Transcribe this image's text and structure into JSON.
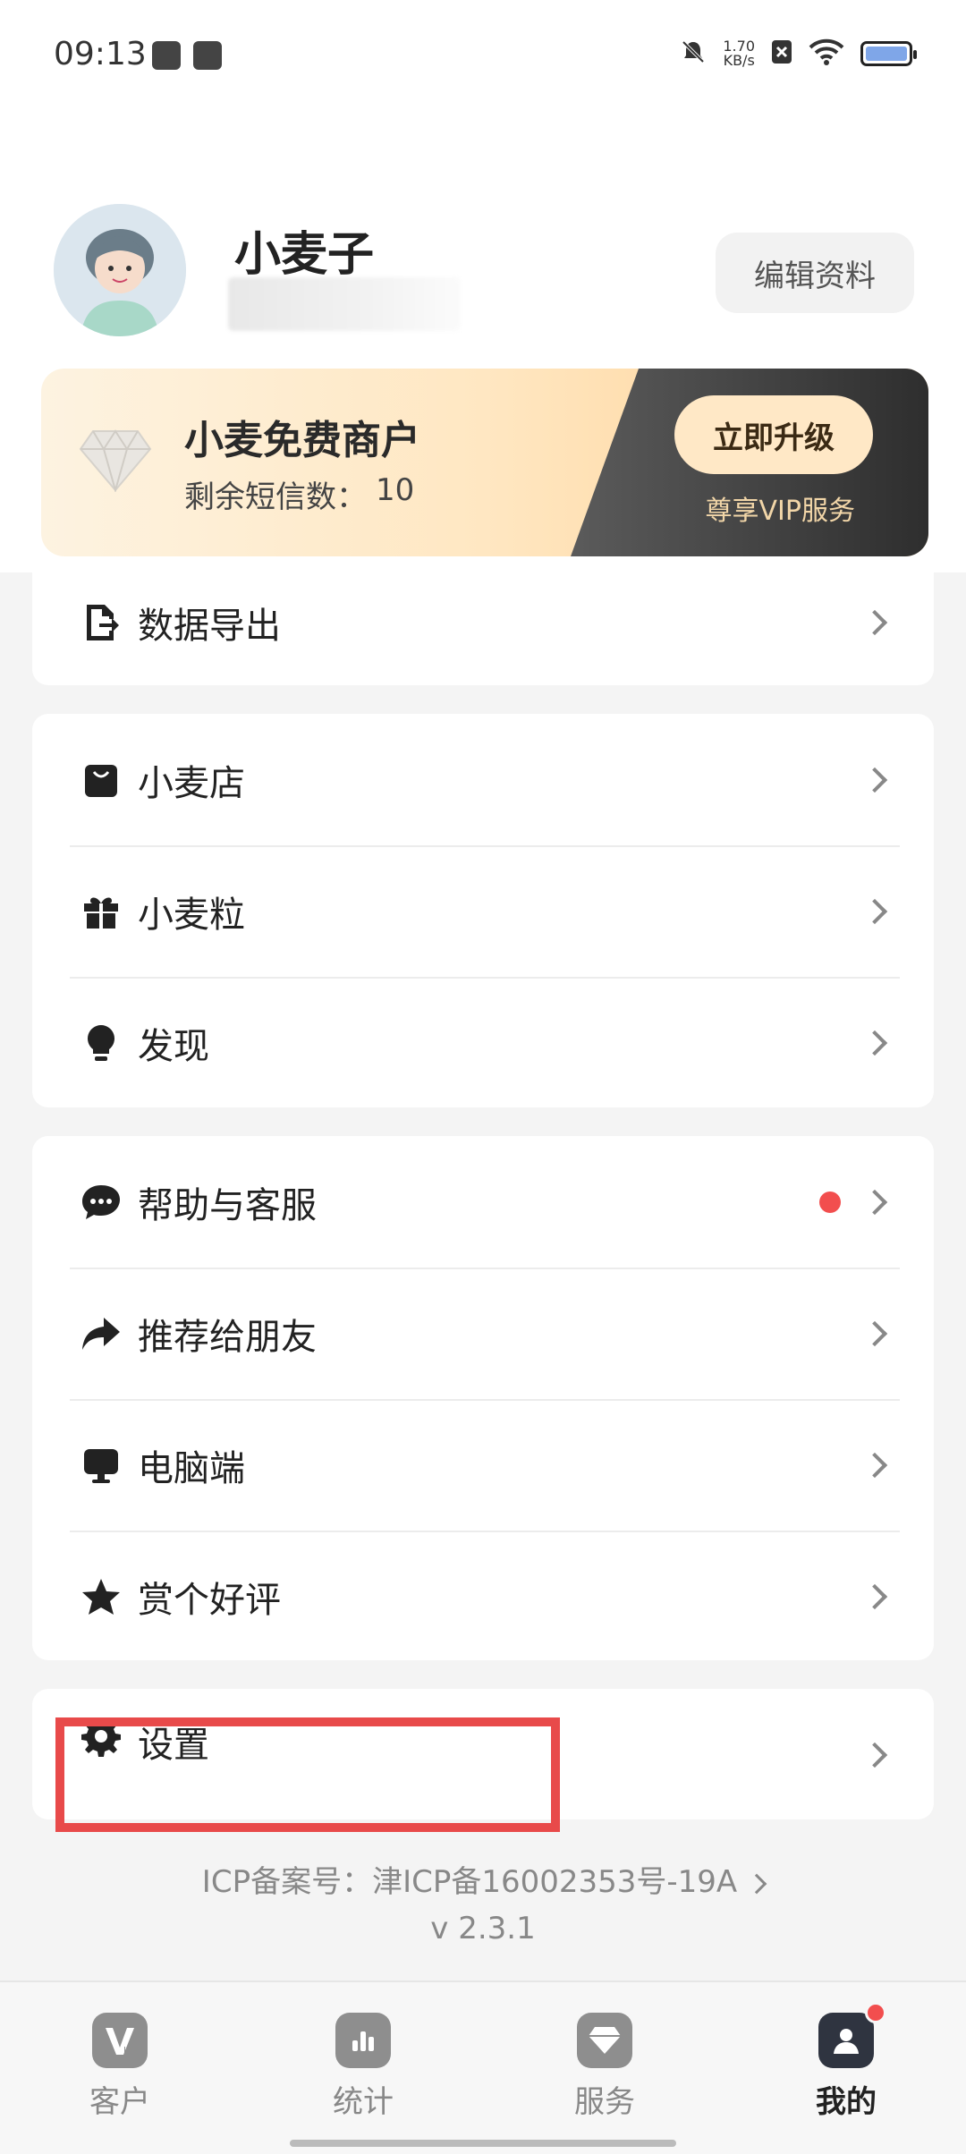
{
  "status": {
    "time": "09:13",
    "speed_value": "1.70",
    "speed_unit": "KB/s"
  },
  "profile": {
    "name": "小麦子",
    "edit_label": "编辑资料"
  },
  "vip": {
    "title": "小麦免费商户",
    "sms_label": "剩余短信数：",
    "sms_count": "10",
    "upgrade_label": "立即升级",
    "service_label": "尊享VIP服务"
  },
  "menu": {
    "export": "数据导出",
    "shop": "小麦店",
    "grain": "小麦粒",
    "discover": "发现",
    "help": "帮助与客服",
    "recommend": "推荐给朋友",
    "desktop": "电脑端",
    "rate": "赏个好评",
    "settings": "设置"
  },
  "footer": {
    "icp": "ICP备案号：津ICP备16002353号-19A",
    "version": "v 2.3.1"
  },
  "tabs": [
    {
      "label": "客户",
      "icon": "vip-customers-icon"
    },
    {
      "label": "统计",
      "icon": "bar-chart-icon"
    },
    {
      "label": "服务",
      "icon": "diamond-icon"
    },
    {
      "label": "我的",
      "icon": "person-icon",
      "active": true
    }
  ],
  "colors": {
    "accent_red": "#f24e4e",
    "vip_gold": "#ffcf8f",
    "vip_dark": "#2e2e2e",
    "highlight": "#e84a4a"
  }
}
